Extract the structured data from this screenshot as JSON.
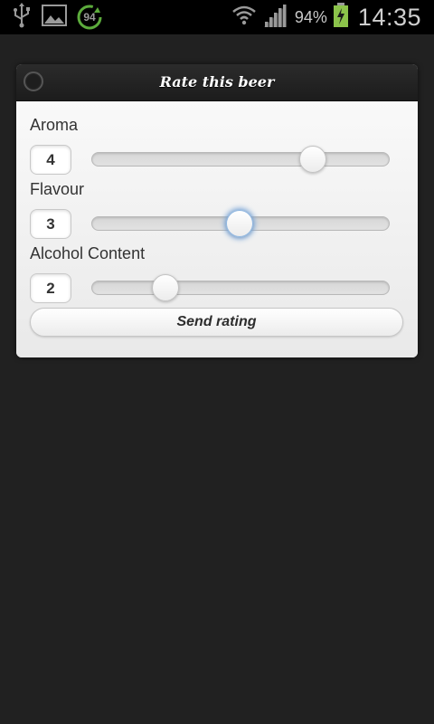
{
  "status_bar": {
    "notification_badge": "94",
    "battery_percent": "94%",
    "time": "14:35",
    "icons": [
      "usb-icon",
      "image-icon",
      "update-badge-icon",
      "wifi-icon",
      "signal-icon",
      "battery-charging-icon"
    ]
  },
  "dialog": {
    "title": "Rate this beer",
    "fields": [
      {
        "label": "Aroma",
        "value": "4",
        "slider_fraction": 0.745
      },
      {
        "label": "Flavour",
        "value": "3",
        "slider_fraction": 0.497
      },
      {
        "label": "Alcohol Content",
        "value": "2",
        "slider_fraction": 0.248
      }
    ],
    "submit_label": "Send rating"
  },
  "colors": {
    "background": "#212121",
    "header": "#1c1c1c",
    "content": "#eeeeee",
    "focus": "#7fa9d9",
    "battery": "#8bc34a"
  }
}
